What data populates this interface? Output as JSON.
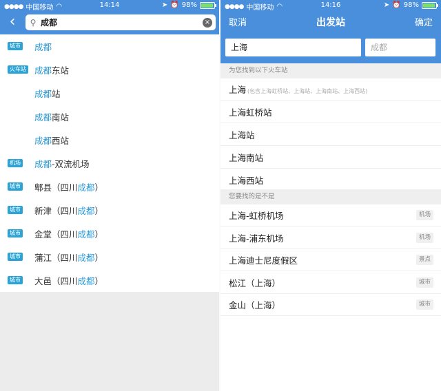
{
  "left": {
    "status": {
      "carrier": "中国移动",
      "time": "14:14",
      "battery": "98%"
    },
    "search": {
      "value": "成都"
    },
    "results": [
      {
        "tag": "城市",
        "hl": "成都",
        "rest": "",
        "pre": "",
        "post": ""
      },
      {
        "tag": "火车站",
        "hl": "成都",
        "rest": "东站",
        "pre": "",
        "post": ""
      },
      {
        "tag": "",
        "hl": "成都",
        "rest": "站",
        "pre": "",
        "post": ""
      },
      {
        "tag": "",
        "hl": "成都",
        "rest": "南站",
        "pre": "",
        "post": ""
      },
      {
        "tag": "",
        "hl": "成都",
        "rest": "西站",
        "pre": "",
        "post": ""
      },
      {
        "tag": "机场",
        "hl": "成都",
        "rest": "-双流机场",
        "pre": "",
        "post": ""
      },
      {
        "tag": "城市",
        "pre": "郫县（四川",
        "hl": "成都",
        "post": "）",
        "rest": ""
      },
      {
        "tag": "城市",
        "pre": "新津（四川",
        "hl": "成都",
        "post": "）",
        "rest": ""
      },
      {
        "tag": "城市",
        "pre": "金堂（四川",
        "hl": "成都",
        "post": "）",
        "rest": ""
      },
      {
        "tag": "城市",
        "pre": "蒲江（四川",
        "hl": "成都",
        "post": "）",
        "rest": ""
      },
      {
        "tag": "城市",
        "pre": "大邑（四川",
        "hl": "成都",
        "post": "）",
        "rest": ""
      }
    ]
  },
  "right": {
    "status": {
      "carrier": "中国移动",
      "time": "14:16",
      "battery": "98%"
    },
    "nav": {
      "cancel": "取消",
      "title": "出发站",
      "confirm": "确定"
    },
    "from_value": "上海",
    "to_placeholder": "成都",
    "section1": "为您找到以下火车站",
    "stations": [
      {
        "name": "上海",
        "note": "(包含上海虹桥站、上海站、上海南站、上海西站)"
      },
      {
        "name": "上海虹桥站",
        "note": ""
      },
      {
        "name": "上海站",
        "note": ""
      },
      {
        "name": "上海南站",
        "note": ""
      },
      {
        "name": "上海西站",
        "note": ""
      }
    ],
    "section2": "您要找的是不是",
    "suggestions": [
      {
        "name": "上海-虹桥机场",
        "tag": "机场"
      },
      {
        "name": "上海-浦东机场",
        "tag": "机场"
      },
      {
        "name": "上海迪士尼度假区",
        "tag": "景点"
      },
      {
        "name": "松江（上海）",
        "tag": "城市"
      },
      {
        "name": "金山（上海）",
        "tag": "城市"
      }
    ]
  },
  "colors": {
    "accent": "#4a8fdc",
    "highlight": "#2b9bd8",
    "tag_bg": "#2aa3d6"
  }
}
